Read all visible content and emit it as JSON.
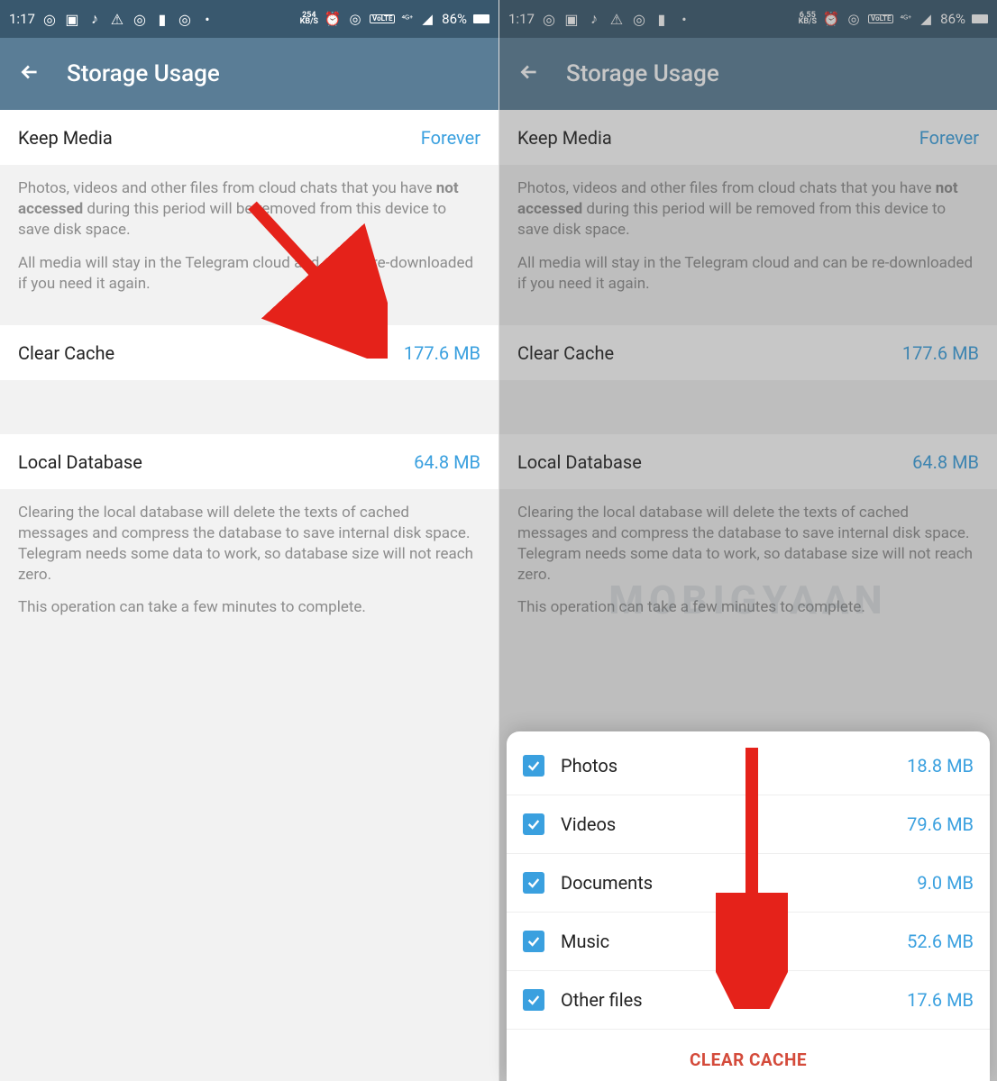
{
  "statusBar": {
    "left": {
      "time": "1:17",
      "speed_top": "254",
      "speed_bot": "KB/S"
    },
    "right": {
      "speed_top": "6.55",
      "speed_bot": "KB/S",
      "volte": "VoLTE",
      "net": "4G",
      "battery": "86%"
    }
  },
  "appBar": {
    "title": "Storage Usage"
  },
  "keepMedia": {
    "label": "Keep Media",
    "value": "Forever"
  },
  "keepMediaDesc": {
    "p1a": "Photos, videos and other files from cloud chats that you have ",
    "p1b": "not accessed",
    "p1c": " during this period will be removed from this device to save disk space.",
    "p2": "All media will stay in the Telegram cloud and can be re-downloaded if you need it again."
  },
  "clearCache": {
    "label": "Clear Cache",
    "value": "177.6 MB"
  },
  "localDb": {
    "label": "Local Database",
    "value": "64.8 MB"
  },
  "localDbDesc": {
    "p1": "Clearing the local database will delete the texts of cached messages and compress the database to save internal disk space. Telegram needs some data to work, so database size will not reach zero.",
    "p2": "This operation can take a few minutes to complete."
  },
  "sheet": {
    "items": [
      {
        "label": "Photos",
        "size": "18.8 MB",
        "checked": true
      },
      {
        "label": "Videos",
        "size": "79.6 MB",
        "checked": true
      },
      {
        "label": "Documents",
        "size": "9.0 MB",
        "checked": true
      },
      {
        "label": "Music",
        "size": "52.6 MB",
        "checked": true
      },
      {
        "label": "Other files",
        "size": "17.6 MB",
        "checked": true
      }
    ],
    "action": "CLEAR CACHE"
  },
  "watermark": "MOBIGYAAN"
}
